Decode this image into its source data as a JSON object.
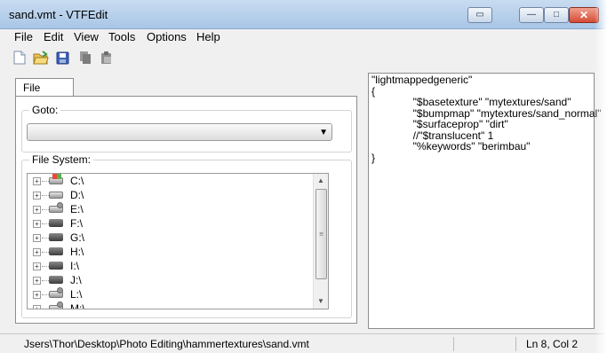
{
  "window": {
    "title": "sand.vmt - VTFEdit",
    "controls": {
      "restore_glyph": "▭",
      "minimize_glyph": "—",
      "maximize_glyph": "□",
      "close_glyph": "✕"
    }
  },
  "menubar": [
    "File",
    "Edit",
    "View",
    "Tools",
    "Options",
    "Help"
  ],
  "toolbar": [
    "new-file-icon",
    "open-folder-icon",
    "save-disk-icon",
    "copy-icon",
    "paste-icon"
  ],
  "left_panel": {
    "tab": "File System",
    "goto_label": "Goto:",
    "goto_value": "",
    "filesystem_label": "File System:",
    "drives": [
      {
        "label": "C:\\",
        "icon": "windows-drive-icon"
      },
      {
        "label": "D:\\",
        "icon": "hard-drive-icon"
      },
      {
        "label": "E:\\",
        "icon": "network-drive-icon"
      },
      {
        "label": "F:\\",
        "icon": "removable-drive-icon"
      },
      {
        "label": "G:\\",
        "icon": "removable-drive-icon"
      },
      {
        "label": "H:\\",
        "icon": "removable-drive-icon"
      },
      {
        "label": "I:\\",
        "icon": "removable-drive-icon"
      },
      {
        "label": "J:\\",
        "icon": "removable-drive-icon"
      },
      {
        "label": "L:\\",
        "icon": "network-drive-icon"
      },
      {
        "label": "M:\\",
        "icon": "network-drive-icon"
      }
    ]
  },
  "editor": {
    "lines": [
      "\"lightmappedgeneric\"",
      "{",
      "              \"$basetexture\" \"mytextures/sand\"",
      "              \"$bumpmap\" \"mytextures/sand_normal\"",
      "              \"$surfaceprop\" \"dirt\"",
      "              //\"$translucent\" 1",
      "              \"%keywords\" \"berimbau\"",
      "}"
    ]
  },
  "statusbar": {
    "path": "Jsers\\Thor\\Desktop\\Photo Editing\\hammertextures\\sand.vmt",
    "position": "Ln 8, Col 2"
  }
}
